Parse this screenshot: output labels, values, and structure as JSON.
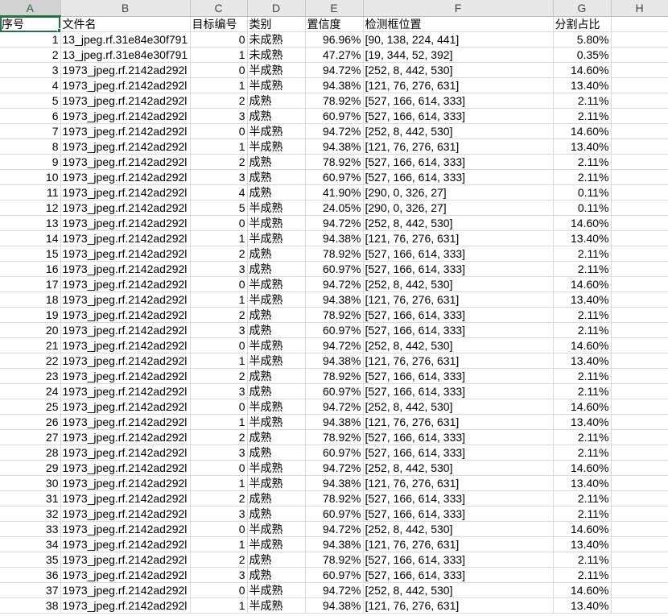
{
  "columns": [
    "A",
    "B",
    "C",
    "D",
    "E",
    "F",
    "G",
    "H"
  ],
  "selected_column": "A",
  "header_row": [
    "序号",
    "文件名",
    "目标编号",
    "类别",
    "置信度",
    "检测框位置",
    "分割占比",
    ""
  ],
  "rows": [
    [
      "1",
      "13_jpeg.rf.31e84e30f791",
      "0",
      "未成熟",
      "96.96%",
      "[90, 138, 224, 441]",
      "5.80%",
      ""
    ],
    [
      "2",
      "13_jpeg.rf.31e84e30f791",
      "1",
      "未成熟",
      "47.27%",
      "[19, 344, 52, 392]",
      "0.35%",
      ""
    ],
    [
      "3",
      "1973_jpeg.rf.2142ad292l",
      "0",
      "半成熟",
      "94.72%",
      "[252, 8, 442, 530]",
      "14.60%",
      ""
    ],
    [
      "4",
      "1973_jpeg.rf.2142ad292l",
      "1",
      "半成熟",
      "94.38%",
      "[121, 76, 276, 631]",
      "13.40%",
      ""
    ],
    [
      "5",
      "1973_jpeg.rf.2142ad292l",
      "2",
      "成熟",
      "78.92%",
      "[527, 166, 614, 333]",
      "2.11%",
      ""
    ],
    [
      "6",
      "1973_jpeg.rf.2142ad292l",
      "3",
      "成熟",
      "60.97%",
      "[527, 166, 614, 333]",
      "2.11%",
      ""
    ],
    [
      "7",
      "1973_jpeg.rf.2142ad292l",
      "0",
      "半成熟",
      "94.72%",
      "[252, 8, 442, 530]",
      "14.60%",
      ""
    ],
    [
      "8",
      "1973_jpeg.rf.2142ad292l",
      "1",
      "半成熟",
      "94.38%",
      "[121, 76, 276, 631]",
      "13.40%",
      ""
    ],
    [
      "9",
      "1973_jpeg.rf.2142ad292l",
      "2",
      "成熟",
      "78.92%",
      "[527, 166, 614, 333]",
      "2.11%",
      ""
    ],
    [
      "10",
      "1973_jpeg.rf.2142ad292l",
      "3",
      "成熟",
      "60.97%",
      "[527, 166, 614, 333]",
      "2.11%",
      ""
    ],
    [
      "11",
      "1973_jpeg.rf.2142ad292l",
      "4",
      "成熟",
      "41.90%",
      "[290, 0, 326, 27]",
      "0.11%",
      ""
    ],
    [
      "12",
      "1973_jpeg.rf.2142ad292l",
      "5",
      "半成熟",
      "24.05%",
      "[290, 0, 326, 27]",
      "0.11%",
      ""
    ],
    [
      "13",
      "1973_jpeg.rf.2142ad292l",
      "0",
      "半成熟",
      "94.72%",
      "[252, 8, 442, 530]",
      "14.60%",
      ""
    ],
    [
      "14",
      "1973_jpeg.rf.2142ad292l",
      "1",
      "半成熟",
      "94.38%",
      "[121, 76, 276, 631]",
      "13.40%",
      ""
    ],
    [
      "15",
      "1973_jpeg.rf.2142ad292l",
      "2",
      "成熟",
      "78.92%",
      "[527, 166, 614, 333]",
      "2.11%",
      ""
    ],
    [
      "16",
      "1973_jpeg.rf.2142ad292l",
      "3",
      "成熟",
      "60.97%",
      "[527, 166, 614, 333]",
      "2.11%",
      ""
    ],
    [
      "17",
      "1973_jpeg.rf.2142ad292l",
      "0",
      "半成熟",
      "94.72%",
      "[252, 8, 442, 530]",
      "14.60%",
      ""
    ],
    [
      "18",
      "1973_jpeg.rf.2142ad292l",
      "1",
      "半成熟",
      "94.38%",
      "[121, 76, 276, 631]",
      "13.40%",
      ""
    ],
    [
      "19",
      "1973_jpeg.rf.2142ad292l",
      "2",
      "成熟",
      "78.92%",
      "[527, 166, 614, 333]",
      "2.11%",
      ""
    ],
    [
      "20",
      "1973_jpeg.rf.2142ad292l",
      "3",
      "成熟",
      "60.97%",
      "[527, 166, 614, 333]",
      "2.11%",
      ""
    ],
    [
      "21",
      "1973_jpeg.rf.2142ad292l",
      "0",
      "半成熟",
      "94.72%",
      "[252, 8, 442, 530]",
      "14.60%",
      ""
    ],
    [
      "22",
      "1973_jpeg.rf.2142ad292l",
      "1",
      "半成熟",
      "94.38%",
      "[121, 76, 276, 631]",
      "13.40%",
      ""
    ],
    [
      "23",
      "1973_jpeg.rf.2142ad292l",
      "2",
      "成熟",
      "78.92%",
      "[527, 166, 614, 333]",
      "2.11%",
      ""
    ],
    [
      "24",
      "1973_jpeg.rf.2142ad292l",
      "3",
      "成熟",
      "60.97%",
      "[527, 166, 614, 333]",
      "2.11%",
      ""
    ],
    [
      "25",
      "1973_jpeg.rf.2142ad292l",
      "0",
      "半成熟",
      "94.72%",
      "[252, 8, 442, 530]",
      "14.60%",
      ""
    ],
    [
      "26",
      "1973_jpeg.rf.2142ad292l",
      "1",
      "半成熟",
      "94.38%",
      "[121, 76, 276, 631]",
      "13.40%",
      ""
    ],
    [
      "27",
      "1973_jpeg.rf.2142ad292l",
      "2",
      "成熟",
      "78.92%",
      "[527, 166, 614, 333]",
      "2.11%",
      ""
    ],
    [
      "28",
      "1973_jpeg.rf.2142ad292l",
      "3",
      "成熟",
      "60.97%",
      "[527, 166, 614, 333]",
      "2.11%",
      ""
    ],
    [
      "29",
      "1973_jpeg.rf.2142ad292l",
      "0",
      "半成熟",
      "94.72%",
      "[252, 8, 442, 530]",
      "14.60%",
      ""
    ],
    [
      "30",
      "1973_jpeg.rf.2142ad292l",
      "1",
      "半成熟",
      "94.38%",
      "[121, 76, 276, 631]",
      "13.40%",
      ""
    ],
    [
      "31",
      "1973_jpeg.rf.2142ad292l",
      "2",
      "成熟",
      "78.92%",
      "[527, 166, 614, 333]",
      "2.11%",
      ""
    ],
    [
      "32",
      "1973_jpeg.rf.2142ad292l",
      "3",
      "成熟",
      "60.97%",
      "[527, 166, 614, 333]",
      "2.11%",
      ""
    ],
    [
      "33",
      "1973_jpeg.rf.2142ad292l",
      "0",
      "半成熟",
      "94.72%",
      "[252, 8, 442, 530]",
      "14.60%",
      ""
    ],
    [
      "34",
      "1973_jpeg.rf.2142ad292l",
      "1",
      "半成熟",
      "94.38%",
      "[121, 76, 276, 631]",
      "13.40%",
      ""
    ],
    [
      "35",
      "1973_jpeg.rf.2142ad292l",
      "2",
      "成熟",
      "78.92%",
      "[527, 166, 614, 333]",
      "2.11%",
      ""
    ],
    [
      "36",
      "1973_jpeg.rf.2142ad292l",
      "3",
      "成熟",
      "60.97%",
      "[527, 166, 614, 333]",
      "2.11%",
      ""
    ],
    [
      "37",
      "1973_jpeg.rf.2142ad292l",
      "0",
      "半成熟",
      "94.72%",
      "[252, 8, 442, 530]",
      "14.60%",
      ""
    ],
    [
      "38",
      "1973_jpeg.rf.2142ad292l",
      "1",
      "半成熟",
      "94.38%",
      "[121, 76, 276, 631]",
      "13.40%",
      ""
    ]
  ],
  "colors": {
    "header_bg": "#e8e8e8",
    "selected_header_bg": "#d2d2d2",
    "selection_green": "#217346",
    "gridline": "#d9d9d9"
  }
}
